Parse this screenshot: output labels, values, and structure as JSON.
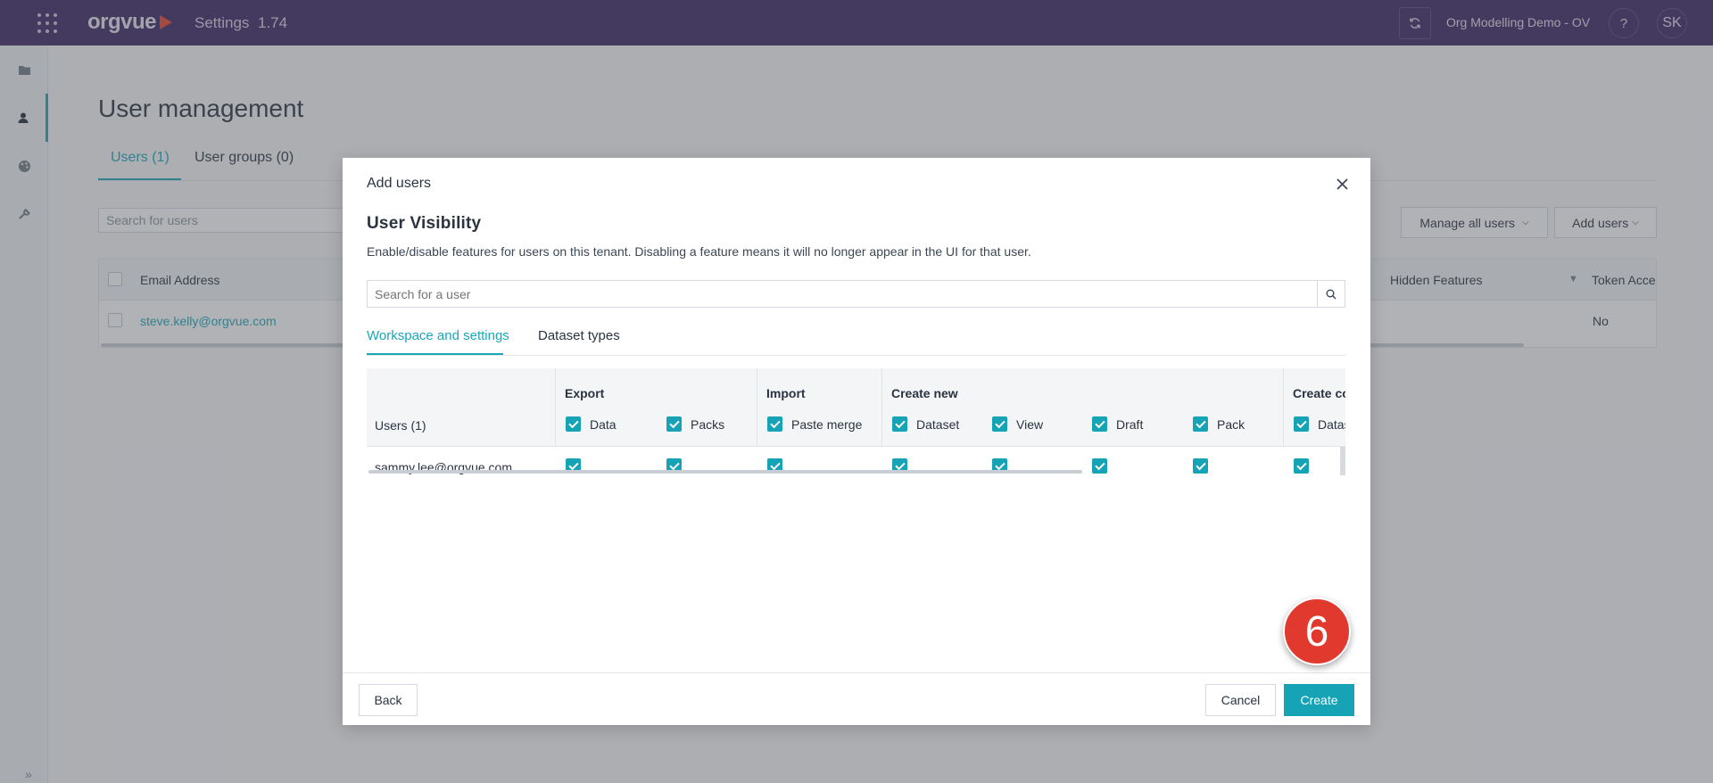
{
  "topbar": {
    "brand": "orgvue",
    "app_title": "Settings",
    "version": "1.74",
    "tenant": "Org Modelling Demo - OV",
    "help_label": "?",
    "avatar_initials": "SK"
  },
  "page": {
    "title": "User management",
    "tabs": [
      {
        "label": "Users (1)"
      },
      {
        "label": "User groups (0)"
      }
    ],
    "search_placeholder": "Search for users",
    "manage_all_users_label": "Manage all users",
    "add_users_label": "Add users",
    "table": {
      "columns": [
        "Email Address",
        "Hidden Features",
        "Token Access"
      ],
      "rows": [
        {
          "email": "steve.kelly@orgvue.com",
          "token_access": "No"
        }
      ]
    }
  },
  "modal": {
    "header_title": "Add users",
    "heading": "User Visibility",
    "description": "Enable/disable features for users on this tenant. Disabling a feature means it will no longer appear in the UI for that user.",
    "search_placeholder": "Search for a user",
    "tabs": [
      {
        "label": "Workspace and settings"
      },
      {
        "label": "Dataset types"
      }
    ],
    "grid": {
      "users_label": "Users (1)",
      "groups": [
        {
          "name": "Export",
          "columns": [
            "Data",
            "Packs"
          ]
        },
        {
          "name": "Import",
          "columns": [
            "Paste merge"
          ]
        },
        {
          "name": "Create new",
          "columns": [
            "Dataset",
            "View",
            "Draft",
            "Pack"
          ]
        },
        {
          "name": "Create co",
          "columns": [
            "Datas"
          ]
        }
      ],
      "rows": [
        {
          "email": "sammy.lee@orgvue.com",
          "checked": [
            true,
            true,
            true,
            true,
            true,
            true,
            true,
            true
          ]
        }
      ]
    },
    "back_label": "Back",
    "cancel_label": "Cancel",
    "create_label": "Create"
  },
  "step_marker": "6",
  "colors": {
    "topbar": "#3b2462",
    "accent": "#17a3b6",
    "logo_mark": "#e8432d",
    "step_marker": "#e2392f"
  }
}
